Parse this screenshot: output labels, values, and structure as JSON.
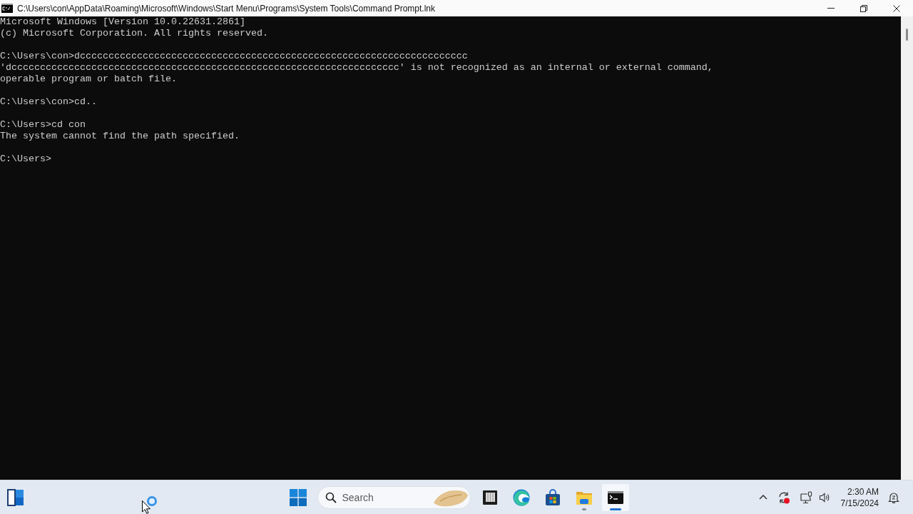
{
  "window": {
    "title": "C:\\Users\\con\\AppData\\Roaming\\Microsoft\\Windows\\Start Menu\\Programs\\System Tools\\Command Prompt.lnk"
  },
  "console": {
    "blocks": [
      [
        "Microsoft Windows [Version 10.0.22631.2861]",
        "(c) Microsoft Corporation. All rights reserved."
      ],
      [
        "C:\\Users\\con>dcccccccccccccccccccccccccccccccccccccccccccccccccccccccccccccccccccc",
        "'dcccccccccccccccccccccccccccccccccccccccccccccccccccccccccccccccccccc' is not recognized as an internal or external command,",
        "operable program or batch file."
      ],
      [
        "C:\\Users\\con>cd.."
      ],
      [
        "C:\\Users>cd con",
        "The system cannot find the path specified."
      ],
      [
        "C:\\Users>"
      ]
    ]
  },
  "taskbar": {
    "search": {
      "placeholder": "Search"
    },
    "apps": [
      {
        "kind": "tile",
        "running": false,
        "selected": false
      },
      {
        "kind": "browser",
        "running": false,
        "selected": false
      },
      {
        "kind": "store",
        "running": false,
        "selected": false
      },
      {
        "kind": "folder",
        "running": true,
        "selected": false
      },
      {
        "kind": "console",
        "running": true,
        "selected": true
      }
    ],
    "clock": {
      "time": "2:30 AM",
      "date": "7/15/2024"
    }
  }
}
